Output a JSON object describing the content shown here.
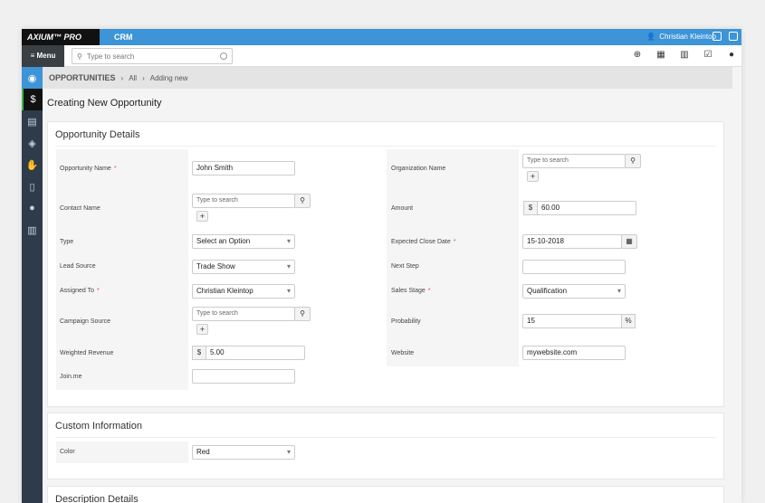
{
  "app": {
    "brand": "AXIUM™ PRO",
    "module": "CRM",
    "user": "Christian Kleintop"
  },
  "toolbar": {
    "menu_label": "≡ Menu",
    "search_placeholder": "Type to search"
  },
  "breadcrumb": {
    "section": "OPPORTUNITIES",
    "all": "All",
    "current": "Adding new"
  },
  "page_title": "Creating New Opportunity",
  "details": {
    "title": "Opportunity Details",
    "opportunity_name_label": "Opportunity Name",
    "opportunity_name_value": "John Smith",
    "organization_name_label": "Organization Name",
    "organization_search_placeholder": "Type to search",
    "contact_name_label": "Contact Name",
    "contact_search_placeholder": "Type to search",
    "amount_label": "Amount",
    "amount_currency": "$",
    "amount_value": "60.00",
    "type_label": "Type",
    "type_value": "Select an Option",
    "expected_close_label": "Expected Close Date",
    "expected_close_value": "15-10-2018",
    "lead_source_label": "Lead Source",
    "lead_source_value": "Trade Show",
    "next_step_label": "Next Step",
    "next_step_value": "",
    "assigned_to_label": "Assigned To",
    "assigned_to_value": "Christian Kleintop",
    "sales_stage_label": "Sales Stage",
    "sales_stage_value": "Qualification",
    "campaign_source_label": "Campaign Source",
    "campaign_search_placeholder": "Type to search",
    "probability_label": "Probability",
    "probability_value": "15",
    "probability_unit": "%",
    "weighted_revenue_label": "Weighted Revenue",
    "weighted_revenue_currency": "$",
    "weighted_revenue_value": "5.00",
    "website_label": "Website",
    "website_value": "mywebsite.com",
    "joinme_label": "Join.me",
    "joinme_value": ""
  },
  "custom": {
    "title": "Custom Information",
    "color_label": "Color",
    "color_value": "Red"
  },
  "description": {
    "title": "Description Details"
  },
  "colors": {
    "accent": "#3d94d6",
    "sidebar": "#2e3b4a",
    "required": "#d9534f"
  }
}
